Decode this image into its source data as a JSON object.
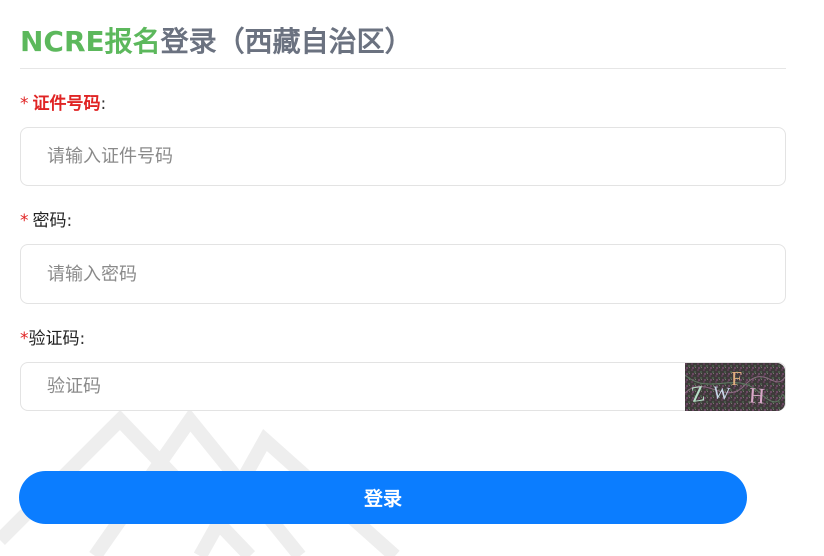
{
  "header": {
    "brand": "NCRE报名",
    "title_rest": "登录（西藏自治区）"
  },
  "form": {
    "id_number": {
      "star": "*",
      "label": "证件号码",
      "colon": ":",
      "placeholder": "请输入证件号码",
      "value": ""
    },
    "password": {
      "star": "*",
      "label": "密码",
      "colon": ":",
      "placeholder": "请输入密码",
      "value": ""
    },
    "captcha": {
      "star": "*",
      "label": "验证码",
      "colon": ":",
      "placeholder": "验证码",
      "value": "",
      "image_text": "ZWFH"
    },
    "submit_label": "登录"
  },
  "colors": {
    "brand_green": "#5cb85c",
    "title_gray": "#6b7280",
    "required_red": "#e02424",
    "primary_blue": "#0b7dff"
  }
}
